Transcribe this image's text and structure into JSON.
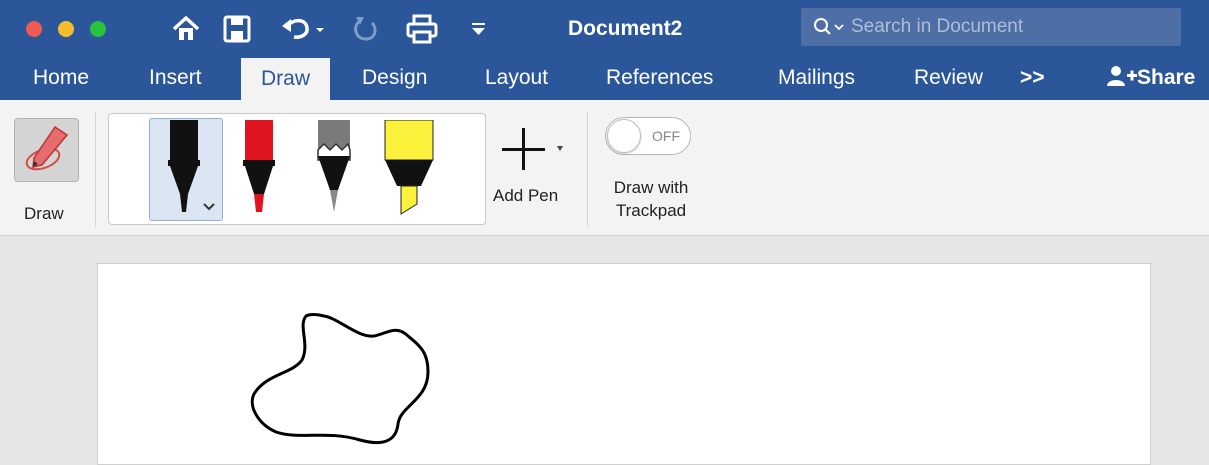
{
  "window": {
    "title": "Document2",
    "search_placeholder": "Search in Document"
  },
  "tabs": [
    {
      "label": "Home"
    },
    {
      "label": "Insert"
    },
    {
      "label": "Draw",
      "active": true
    },
    {
      "label": "Design"
    },
    {
      "label": "Layout"
    },
    {
      "label": "References"
    },
    {
      "label": "Mailings"
    },
    {
      "label": "Review"
    },
    {
      "label": ">>"
    }
  ],
  "share_label": "Share",
  "ribbon": {
    "draw_label": "Draw",
    "add_pen_label": "Add Pen",
    "toggle_state": "OFF",
    "trackpad_label_line1": "Draw with",
    "trackpad_label_line2": "Trackpad",
    "pens": [
      {
        "name": "black-pen",
        "color": "#111111",
        "selected": true
      },
      {
        "name": "red-pen",
        "color": "#e0141e"
      },
      {
        "name": "gray-pencil",
        "color": "#808080"
      },
      {
        "name": "yellow-highlighter",
        "color": "#fbf03a"
      }
    ]
  },
  "colors": {
    "accent": "#2b579a",
    "ribbon_bg": "#f3f3f3"
  }
}
